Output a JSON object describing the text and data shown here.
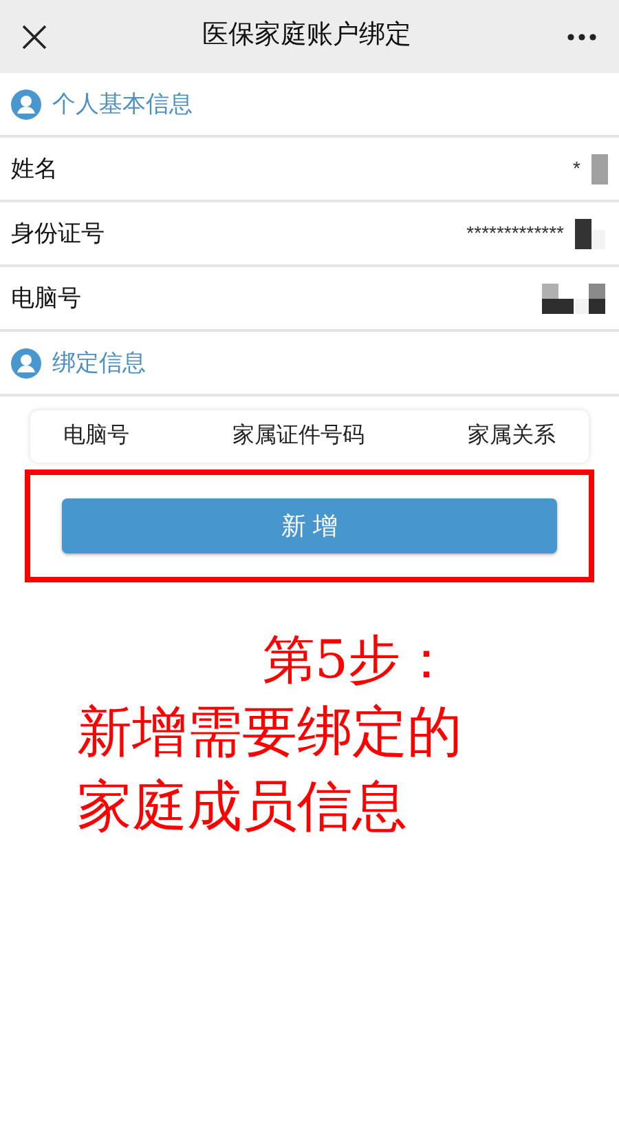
{
  "title": "医保家庭账户绑定",
  "sections": [
    {
      "title": "个人基本信息",
      "rows": [
        {
          "label": "姓名",
          "value": "*"
        },
        {
          "label": "身份证号",
          "value": "*************"
        },
        {
          "label": "电脑号",
          "value": ""
        }
      ]
    },
    {
      "title": "绑定信息"
    }
  ],
  "table": {
    "columns": [
      "电脑号",
      "家属证件号码",
      "家属关系"
    ]
  },
  "add_button": "新 增",
  "annotation": {
    "step": "第5步：",
    "lines": [
      "新增需要绑定的",
      "家庭成员信息"
    ]
  }
}
